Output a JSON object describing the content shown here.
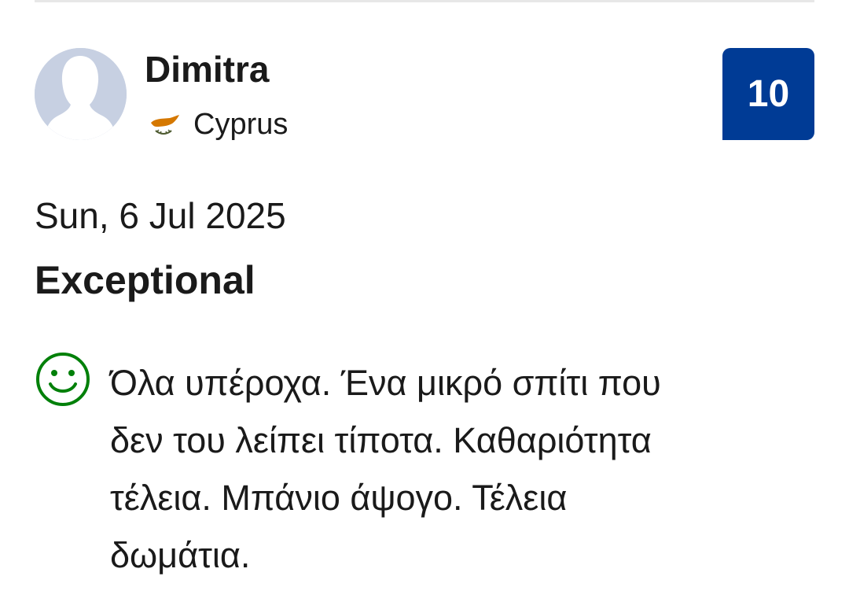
{
  "review": {
    "reviewer": {
      "name": "Dimitra",
      "country": "Cyprus",
      "avatar_icon": "person-silhouette-icon",
      "flag_icon": "cyprus-flag-icon"
    },
    "score": "10",
    "date": "Sun, 6 Jul 2025",
    "title": "Exceptional",
    "positive": {
      "icon": "smiley-face-icon",
      "lines": [
        "Όλα υπέροχα. Ένα μικρό σπίτι που",
        "δεν του λείπει τίποτα. Καθαριότητα",
        "τέλεια. Μπάνιο άψογο. Τέλεια",
        "δωμάτια."
      ]
    }
  },
  "colors": {
    "score_badge_bg": "#003b95",
    "positive_icon": "#008009",
    "avatar_bg": "#c7d0e2",
    "text": "#1a1a1a"
  }
}
